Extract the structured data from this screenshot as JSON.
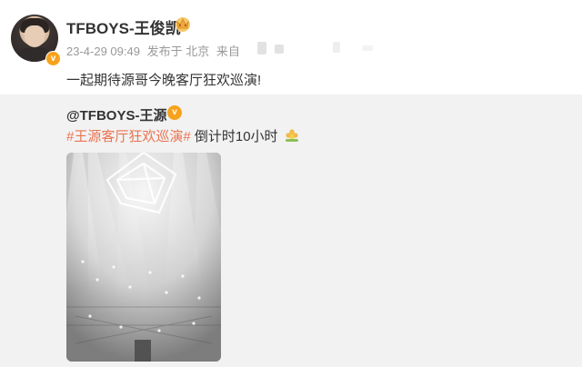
{
  "post": {
    "username": "TFBOYS-王俊凯",
    "meta": {
      "time": "23-4-29 09:49",
      "published_at": "发布于 北京",
      "source_prefix": "来自"
    },
    "text": "一起期待源哥今晚客厅狂欢巡演!",
    "icons": {
      "avatar": "avatar-photo",
      "verified": "verified-v-badge",
      "crown": "crown-emoji-icon"
    }
  },
  "repost": {
    "username": "@TFBOYS-王源",
    "hashtag": "#王源客厅狂欢巡演#",
    "text": " 倒计时10小时",
    "icons": {
      "verified": "verified-v-badge",
      "emoji": "flower-emoji-icon",
      "image": "concert-stage-photo"
    }
  },
  "colors": {
    "hashtag": "#eb7350",
    "verified": "#f7a21b",
    "repost_background": "#f2f2f2",
    "meta": "#999999"
  }
}
